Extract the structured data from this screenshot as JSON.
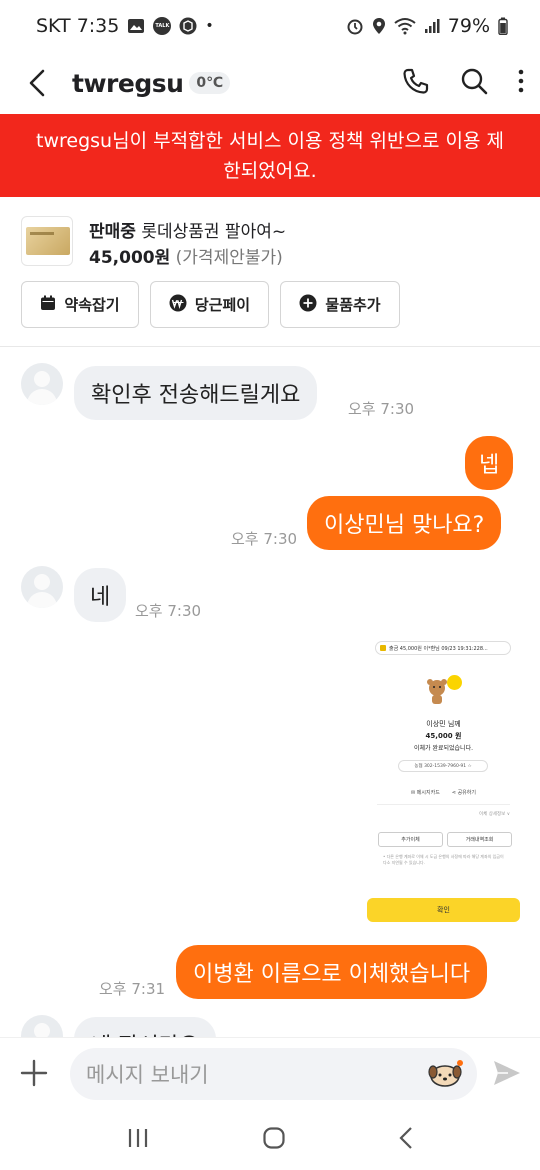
{
  "status_bar": {
    "carrier_time": "SKT 7:35",
    "dot": "•",
    "battery": "79%"
  },
  "header": {
    "title": "twregsu",
    "temperature": "0℃"
  },
  "banner": {
    "text": "twregsu님이 부적합한 서비스 이용 정책 위반으로 이용 제한되었어요."
  },
  "product": {
    "status": "판매중",
    "name": "롯데상품권 팔아여~",
    "price": "45,000원",
    "price_note": "(가격제안불가)",
    "buttons": [
      {
        "label": "약속잡기",
        "icon": "calendar-icon"
      },
      {
        "label": "당근페이",
        "icon": "won-icon"
      },
      {
        "label": "물품추가",
        "icon": "plus-circle-icon"
      }
    ]
  },
  "messages": [
    {
      "side": "in",
      "text": "확인후 전송해드릴게요",
      "time": "오후 7:30"
    },
    {
      "side": "out",
      "text": "넵",
      "time": ""
    },
    {
      "side": "out",
      "text": "이상민님 맞나요?",
      "time": "오후 7:30"
    },
    {
      "side": "in",
      "text": "네",
      "time": "오후 7:30"
    },
    {
      "side": "out",
      "text": "이병환 이름으로 이체했습니다",
      "time": "오후 7:31"
    },
    {
      "side": "in",
      "text": "네 잠시만요",
      "time": ""
    }
  ],
  "receipt": {
    "top_text": "출금 45,000원  이*환님 09/23 19:31:228...",
    "recipient": "이상민 님께",
    "amount": "45,000 원",
    "status": "이체가 완료되었습니다.",
    "account": "농협  302-1539-7960-91 ☆",
    "link1": "✉ 메시지카드",
    "link2": "⋖ 공유하기",
    "detail": "이체 상세정보 ∨",
    "btn1": "추가이체",
    "btn2": "거래내역조회",
    "note": "• 다른 은행 계좌로 이체 시 도금 은행의 사정에 따라 해당 계좌의 입금이 다소 지연될 수 있습니다.",
    "confirm": "확인"
  },
  "input": {
    "placeholder": "메시지 보내기"
  },
  "colors": {
    "accent": "#ff6f0f",
    "banner": "#f2271c",
    "incoming_bubble": "#eef0f3"
  }
}
